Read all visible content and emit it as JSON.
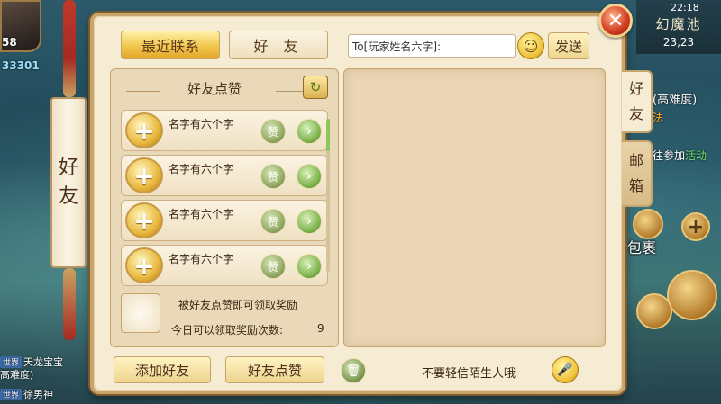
{
  "hud": {
    "level": "58",
    "power": "33301",
    "clock": "22:18",
    "map_name": "幻魔池",
    "coords": "23,23",
    "quest_title": "(高难度)",
    "quest_sub": "法",
    "quest_goto": "往参加",
    "quest_goto_link": "活动",
    "bag_label": "包裹",
    "chat_line1_tag": "世界",
    "chat_line1": "天龙宝宝",
    "chat_line1b": "高难度)",
    "chat_line2_tag": "世界",
    "chat_line2": "徐男神"
  },
  "side_scroll": {
    "char1": "好",
    "char2": "友"
  },
  "panel": {
    "tab_recent": "最近联系",
    "tab_friends": "好 友",
    "to_input_value": "To[玩家姓名六字]:",
    "emoji_icon": "☺",
    "send_label": "发送",
    "close_icon": "✕",
    "section_title": "好友点赞",
    "refresh_icon": "↻",
    "friends": [
      {
        "name": "名字有六个字",
        "like": "赞"
      },
      {
        "name": "名字有六个字",
        "like": "赞"
      },
      {
        "name": "名字有六个字",
        "like": "赞"
      },
      {
        "name": "名字有六个字",
        "like": "赞"
      }
    ],
    "plus_icon": "+",
    "arrow_icon": "›",
    "reward_text": "被好友点赞即可领取奖励",
    "reward_count_label": "今日可以领取奖励次数:",
    "reward_count_value": "9",
    "add_friend": "添加好友",
    "friend_like": "好友点赞",
    "trash_icon": "🗑",
    "warning": "不要轻信陌生人哦",
    "mic_icon": "🎤",
    "side_tab_friends": [
      "好",
      "友"
    ],
    "side_tab_mail": [
      "邮",
      "箱"
    ]
  }
}
